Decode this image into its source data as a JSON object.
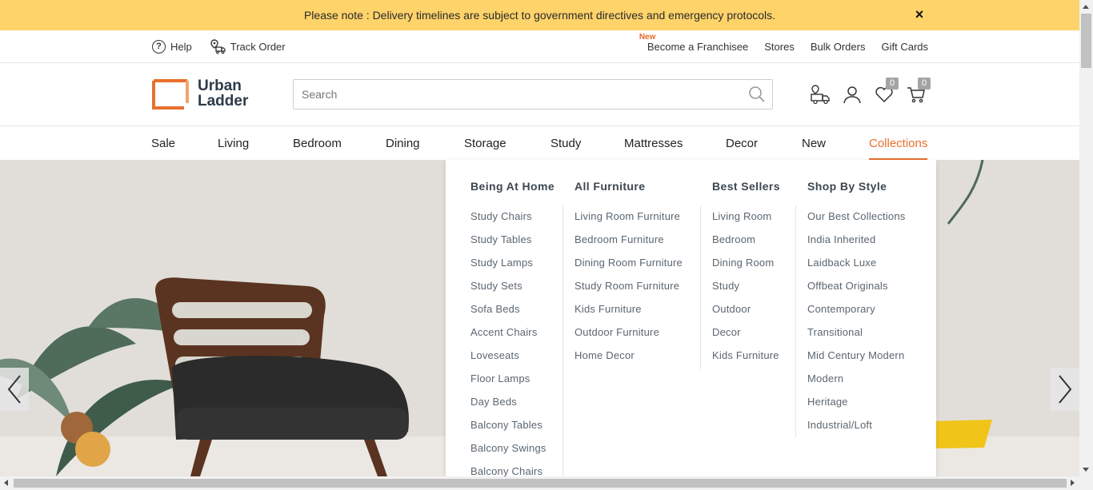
{
  "notice": {
    "text": "Please note : Delivery timelines are subject to government directives and emergency protocols.",
    "close_label": "×"
  },
  "utility_left": [
    {
      "icon": "help-icon",
      "label": "Help"
    },
    {
      "icon": "track-order-icon",
      "label": "Track Order"
    }
  ],
  "utility_right": {
    "new_badge": "New",
    "items": [
      "Become a Franchisee",
      "Stores",
      "Bulk Orders",
      "Gift Cards"
    ]
  },
  "logo": {
    "line1": "Urban",
    "line2": "Ladder"
  },
  "search": {
    "placeholder": "Search"
  },
  "header_icons": {
    "wishlist_count": "0",
    "cart_count": "0"
  },
  "nav": [
    "Sale",
    "Living",
    "Bedroom",
    "Dining",
    "Storage",
    "Study",
    "Mattresses",
    "Decor",
    "New",
    "Collections"
  ],
  "nav_active": "Collections",
  "menu": {
    "columns": [
      {
        "title": "Being At Home",
        "items": [
          "Study Chairs",
          "Study Tables",
          "Study Lamps",
          "Study Sets",
          "Sofa Beds",
          "Accent Chairs",
          "Loveseats",
          "Floor Lamps",
          "Day Beds",
          "Balcony Tables",
          "Balcony Swings",
          "Balcony Chairs"
        ]
      },
      {
        "title": "All Furniture",
        "items": [
          "Living Room Furniture",
          "Bedroom Furniture",
          "Dining Room Furniture",
          "Study Room Furniture",
          "Kids Furniture",
          "Outdoor Furniture",
          "Home Decor"
        ]
      },
      {
        "title": "Best Sellers",
        "items": [
          "Living Room",
          "Bedroom",
          "Dining Room",
          "Study",
          "Outdoor",
          "Decor",
          "Kids Furniture"
        ]
      },
      {
        "title": "Shop By Style",
        "items": [
          "Our Best Collections",
          "India Inherited",
          "Laidback Luxe",
          "Offbeat Originals",
          "Contemporary",
          "Transitional",
          "Mid Century Modern",
          "Modern",
          "Heritage",
          "Industrial/Loft"
        ]
      }
    ]
  },
  "colors": {
    "accent": "#e8702e",
    "notice_bg": "#fdd36a",
    "text": "#333333"
  }
}
